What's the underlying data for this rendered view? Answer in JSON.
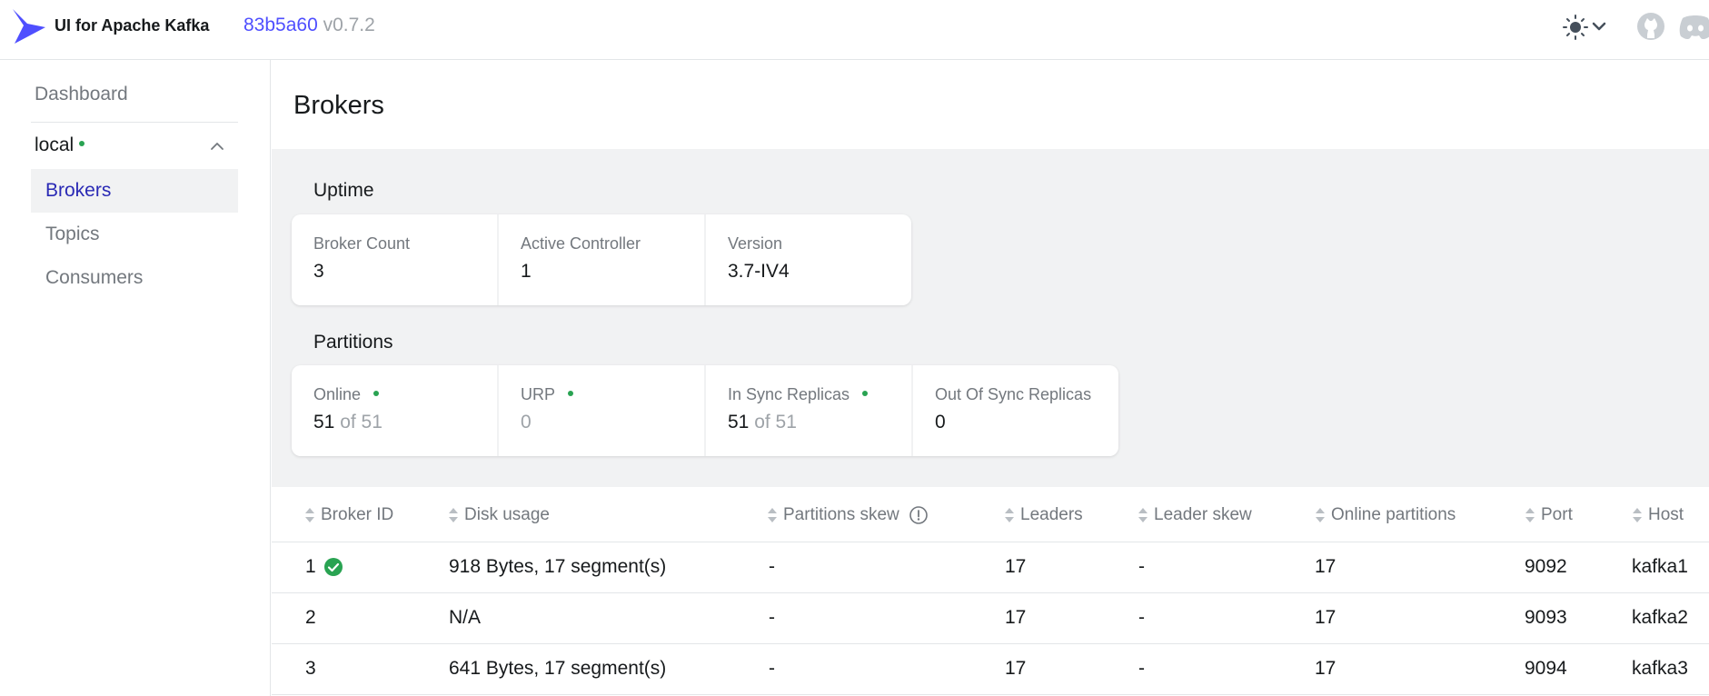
{
  "app": {
    "title": "UI for Apache Kafka",
    "commit_hash": "83b5a60",
    "version": "v0.7.2"
  },
  "header_icons": {
    "theme": "sun-icon",
    "theme_dropdown": "chevron-down-icon",
    "github": "github-icon",
    "discord": "discord-icon"
  },
  "sidebar": {
    "dashboard": "Dashboard",
    "cluster": {
      "name": "local",
      "status": "online",
      "items": [
        {
          "label": "Brokers",
          "active": true
        },
        {
          "label": "Topics",
          "active": false
        },
        {
          "label": "Consumers",
          "active": false
        }
      ]
    }
  },
  "page": {
    "title": "Brokers"
  },
  "uptime": {
    "label": "Uptime",
    "stats": [
      {
        "label": "Broker Count",
        "value": "3"
      },
      {
        "label": "Active Controller",
        "value": "1"
      },
      {
        "label": "Version",
        "value": "3.7-IV4"
      }
    ]
  },
  "partitions": {
    "label": "Partitions",
    "stats": [
      {
        "label": "Online",
        "value": "51",
        "of": "of 51",
        "dot": true
      },
      {
        "label": "URP",
        "value": "0",
        "dot": true
      },
      {
        "label": "In Sync Replicas",
        "value": "51",
        "of": "of 51",
        "dot": true
      },
      {
        "label": "Out Of Sync Replicas",
        "value": "0"
      }
    ]
  },
  "table": {
    "columns": [
      "Broker ID",
      "Disk usage",
      "Partitions skew",
      "Leaders",
      "Leader skew",
      "Online partitions",
      "Port",
      "Host"
    ],
    "rows": [
      {
        "id": "1",
        "controller": true,
        "disk": "918 Bytes, 17 segment(s)",
        "partitions_skew": "-",
        "leaders": "17",
        "leader_skew": "-",
        "online": "17",
        "port": "9092",
        "host": "kafka1"
      },
      {
        "id": "2",
        "controller": false,
        "disk": "N/A",
        "partitions_skew": "-",
        "leaders": "17",
        "leader_skew": "-",
        "online": "17",
        "port": "9093",
        "host": "kafka2"
      },
      {
        "id": "3",
        "controller": false,
        "disk": "641 Bytes, 17 segment(s)",
        "partitions_skew": "-",
        "leaders": "17",
        "leader_skew": "-",
        "online": "17",
        "port": "9094",
        "host": "kafka3"
      }
    ]
  },
  "colors": {
    "accent": "#4f4fff",
    "active_nav": "#2a2ab5",
    "success": "#29a352",
    "muted": "#9ea3a8"
  }
}
